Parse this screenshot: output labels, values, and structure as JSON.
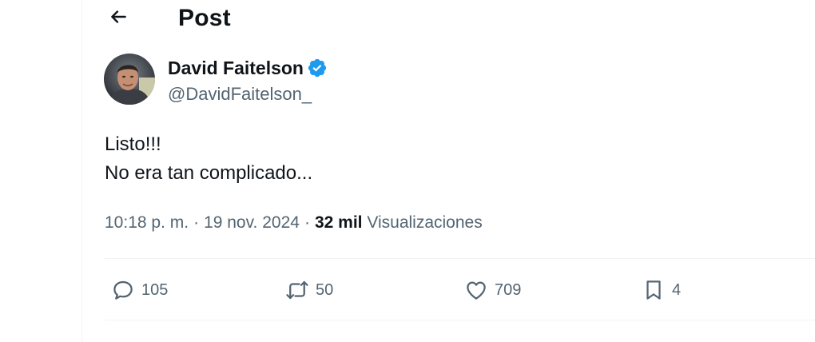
{
  "header": {
    "back_icon": "arrow-left-icon",
    "title": "Post"
  },
  "author": {
    "name": "David Faitelson",
    "handle": "@DavidFaitelson_",
    "verified": true,
    "verified_icon": "verified-badge-icon",
    "verified_color": "#1d9bf0"
  },
  "tweet": {
    "lines": [
      "Listo!!!",
      "No era tan complicado..."
    ]
  },
  "meta": {
    "time": "10:18 p. m.",
    "separator": "·",
    "date": "19 nov. 2024",
    "views_count": "32 mil",
    "views_label": "Visualizaciones"
  },
  "actions": {
    "reply": {
      "icon": "reply-bubble-icon",
      "count": "105"
    },
    "retweet": {
      "icon": "retweet-icon",
      "count": "50"
    },
    "like": {
      "icon": "heart-icon",
      "count": "709"
    },
    "bookmark": {
      "icon": "bookmark-icon",
      "count": "4"
    }
  },
  "colors": {
    "text_primary": "#0f1419",
    "text_secondary": "#536471",
    "divider": "#eff3f4",
    "accent": "#1d9bf0"
  }
}
